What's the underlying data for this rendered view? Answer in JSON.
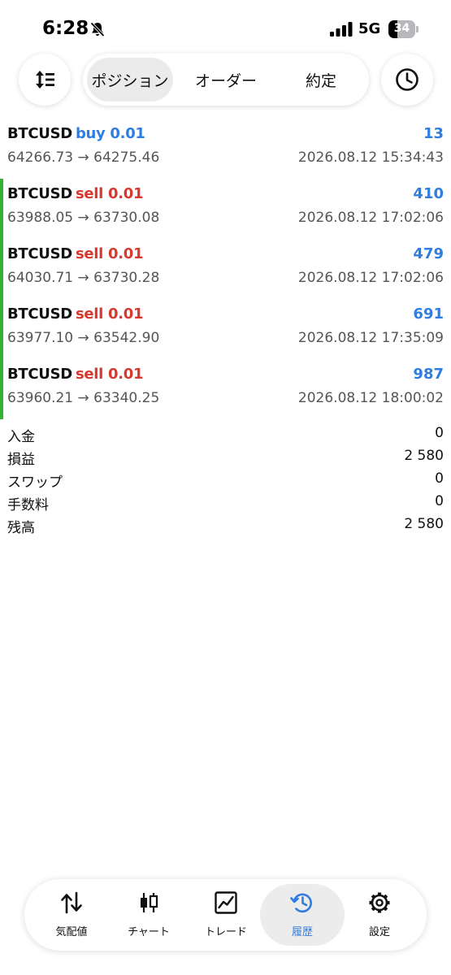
{
  "status": {
    "time": "6:28",
    "network": "5G",
    "battery": "34",
    "battery_level": 34
  },
  "tabs": [
    {
      "label": "ポジション",
      "active": true
    },
    {
      "label": "オーダー",
      "active": false
    },
    {
      "label": "約定",
      "active": false
    }
  ],
  "deals": [
    {
      "symbol": "BTCUSD",
      "type": "buy 0.01",
      "side": "buy",
      "profit": "13",
      "prices": "64266.73 → 64275.46",
      "time": "2026.08.12 15:34:43",
      "marked": false
    },
    {
      "symbol": "BTCUSD",
      "type": "sell 0.01",
      "side": "sell",
      "profit": "410",
      "prices": "63988.05 → 63730.08",
      "time": "2026.08.12 17:02:06",
      "marked": true
    },
    {
      "symbol": "BTCUSD",
      "type": "sell 0.01",
      "side": "sell",
      "profit": "479",
      "prices": "64030.71 → 63730.28",
      "time": "2026.08.12 17:02:06",
      "marked": true
    },
    {
      "symbol": "BTCUSD",
      "type": "sell 0.01",
      "side": "sell",
      "profit": "691",
      "prices": "63977.10 → 63542.90",
      "time": "2026.08.12 17:35:09",
      "marked": true
    },
    {
      "symbol": "BTCUSD",
      "type": "sell 0.01",
      "side": "sell",
      "profit": "987",
      "prices": "63960.21 → 63340.25",
      "time": "2026.08.12 18:00:02",
      "marked": true
    }
  ],
  "summary": [
    {
      "label": "入金",
      "value": "0"
    },
    {
      "label": "損益",
      "value": "2 580"
    },
    {
      "label": "スワップ",
      "value": "0"
    },
    {
      "label": "手数料",
      "value": "0"
    },
    {
      "label": "残高",
      "value": "2 580"
    }
  ],
  "bottom_tabs": [
    {
      "label": "気配値",
      "icon": "quotes-arrows-icon",
      "active": false
    },
    {
      "label": "チャート",
      "icon": "candlestick-chart-icon",
      "active": false
    },
    {
      "label": "トレード",
      "icon": "trade-graph-icon",
      "active": false
    },
    {
      "label": "履歴",
      "icon": "history-clock-icon",
      "active": true
    },
    {
      "label": "設定",
      "icon": "gear-icon",
      "active": false
    }
  ],
  "colors": {
    "accent": "#2f7de1",
    "sell": "#d6392f",
    "marker": "#34b233"
  }
}
